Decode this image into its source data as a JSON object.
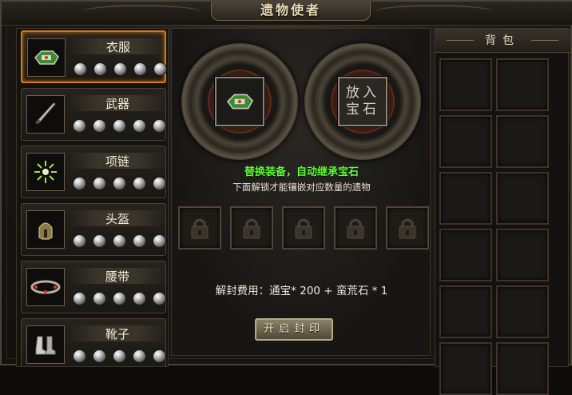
{
  "window": {
    "title": "遗物使者"
  },
  "equipment_slots": [
    {
      "label": "衣服",
      "icon": "armor-icon",
      "selected": true
    },
    {
      "label": "武器",
      "icon": "sword-icon",
      "selected": false
    },
    {
      "label": "项链",
      "icon": "necklace-icon",
      "selected": false
    },
    {
      "label": "头盔",
      "icon": "helmet-icon",
      "selected": false
    },
    {
      "label": "腰带",
      "icon": "belt-icon",
      "selected": false
    },
    {
      "label": "靴子",
      "icon": "boots-icon",
      "selected": false
    }
  ],
  "center": {
    "gem_placeholder_line1": "放入",
    "gem_placeholder_line2": "宝石",
    "hint_primary": "替换装备，自动继承宝石",
    "hint_secondary": "下面解锁才能镶嵌对应数量的遗物",
    "cost_text": "解封费用：通宝* 200 + 蛮荒石 * 1",
    "unseal_button": "开启封印"
  },
  "backpack": {
    "title": "背包"
  },
  "colors": {
    "hint_green": "#5dff2e",
    "selected_border": "#d07a1c"
  }
}
